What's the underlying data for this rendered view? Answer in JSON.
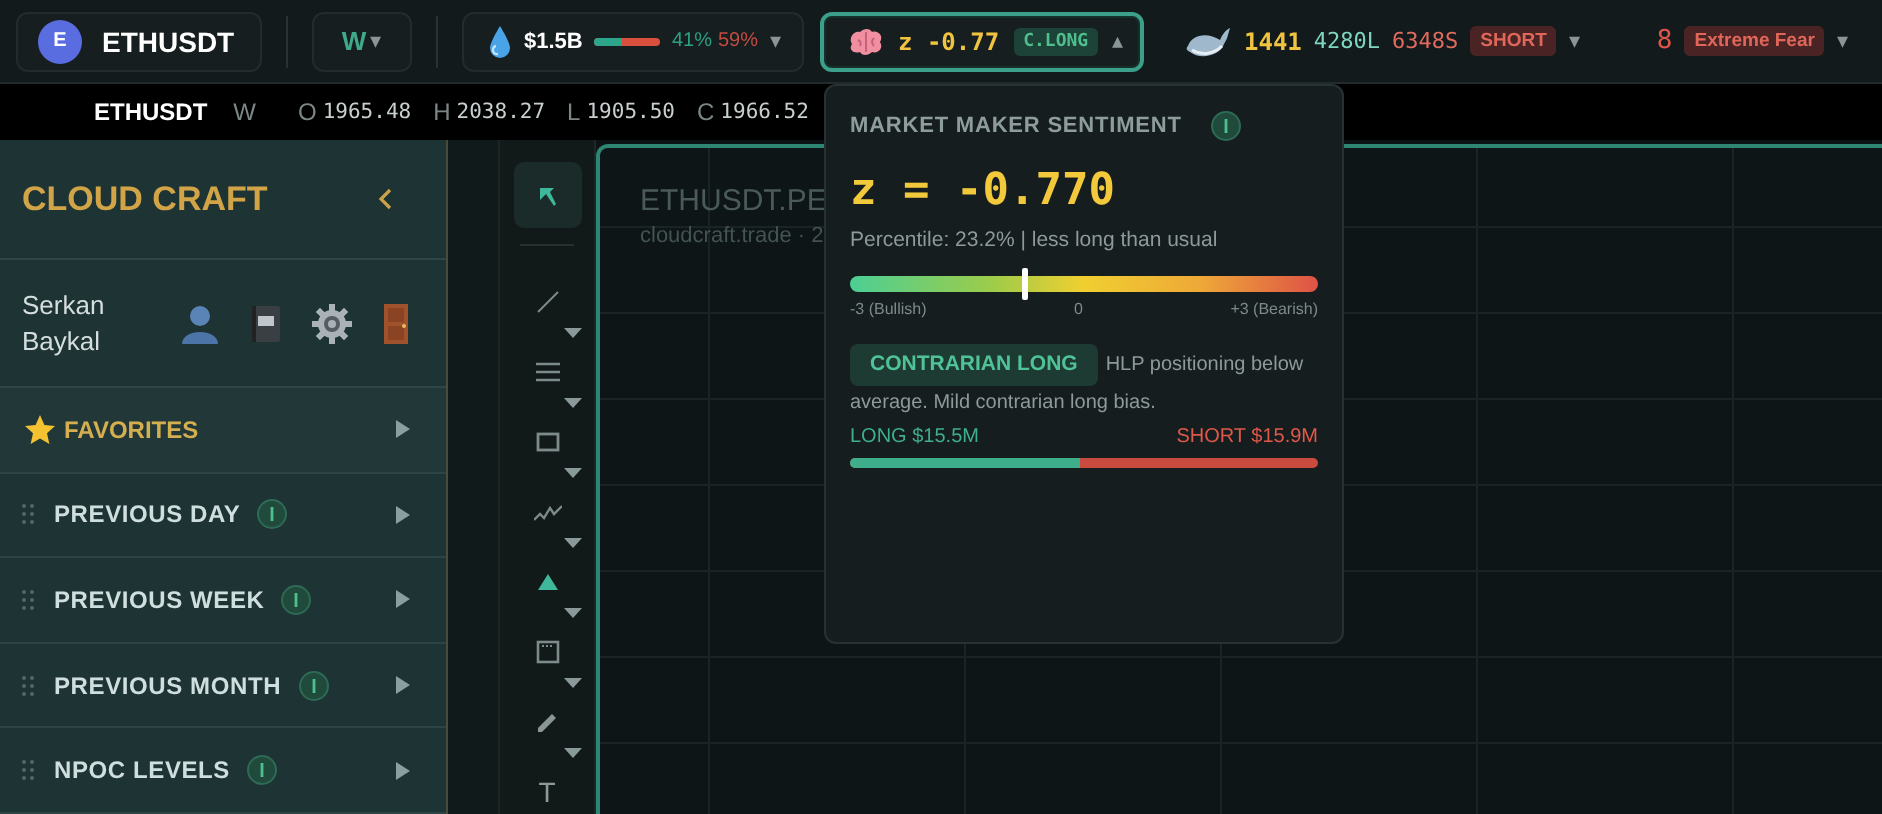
{
  "top_bar": {
    "symbol": {
      "badge": "E",
      "label": "ETHUSDT"
    },
    "timeframe": {
      "label": "W",
      "caret": "▾"
    },
    "liquidity": {
      "amount": "$1.5B",
      "level": 0.41,
      "long_pct": "41%",
      "short_pct": "59%",
      "caret": "▾"
    },
    "sentiment": {
      "label": "z -0.77",
      "tag": "C.LONG",
      "caret": "▴",
      "expanded": true
    },
    "whales": {
      "count": "1441",
      "long": "4280L",
      "short": "6348S",
      "bias": "SHORT",
      "caret": "▾"
    },
    "fear_greed": {
      "value": "8",
      "label": "Extreme Fear",
      "caret": "▾"
    }
  },
  "ohlc_bar": {
    "symbol": "ETHUSDT",
    "timeframe": "W",
    "values": [
      {
        "key": "O",
        "value": "1965.48"
      },
      {
        "key": "H",
        "value": "2038.27"
      },
      {
        "key": "L",
        "value": "1905.50"
      },
      {
        "key": "C",
        "value": "1966.52"
      }
    ]
  },
  "sidebar": {
    "title": "CLOUD CRAFT",
    "user": {
      "first_name": "Serkan",
      "last_name": "Baykal"
    },
    "sections": [
      {
        "kind": "favorites",
        "label": "FAVORITES"
      },
      {
        "kind": "group",
        "label": "PREVIOUS DAY"
      },
      {
        "kind": "group",
        "label": "PREVIOUS WEEK"
      },
      {
        "kind": "group",
        "label": "PREVIOUS MONTH"
      },
      {
        "kind": "group",
        "label": "NPOC LEVELS"
      }
    ]
  },
  "toolbar": {
    "tools": [
      {
        "kind": "cursor",
        "selected": true
      },
      {
        "kind": "line",
        "selected": false
      },
      {
        "kind": "lines",
        "selected": false
      },
      {
        "kind": "rectangle",
        "selected": false
      },
      {
        "kind": "zigzag",
        "selected": false
      },
      {
        "kind": "triangle",
        "selected": false
      },
      {
        "kind": "frame",
        "selected": false
      },
      {
        "kind": "pencil",
        "selected": false
      },
      {
        "kind": "text",
        "label": "T",
        "selected": false
      }
    ]
  },
  "chart": {
    "title": "ETHUSDT.PE",
    "subtitle": "cloudcraft.trade · 2"
  },
  "sentiment_popup": {
    "title": "MARKET MAKER SENTIMENT",
    "z": "z = -0.770",
    "percentile": "Percentile: 23.2% | less long than usual",
    "gauge": {
      "level": 0.37,
      "labels": [
        "-3 (Bullish)",
        "0",
        "+3 (Bearish)"
      ]
    },
    "signal": "CONTRARIAN LONG",
    "description_lines": [
      "HLP positioning below",
      "average. Mild contrarian long bias."
    ],
    "long": "LONG $15.5M",
    "short": "SHORT $15.9M",
    "balance": {
      "level": 0.49
    }
  }
}
